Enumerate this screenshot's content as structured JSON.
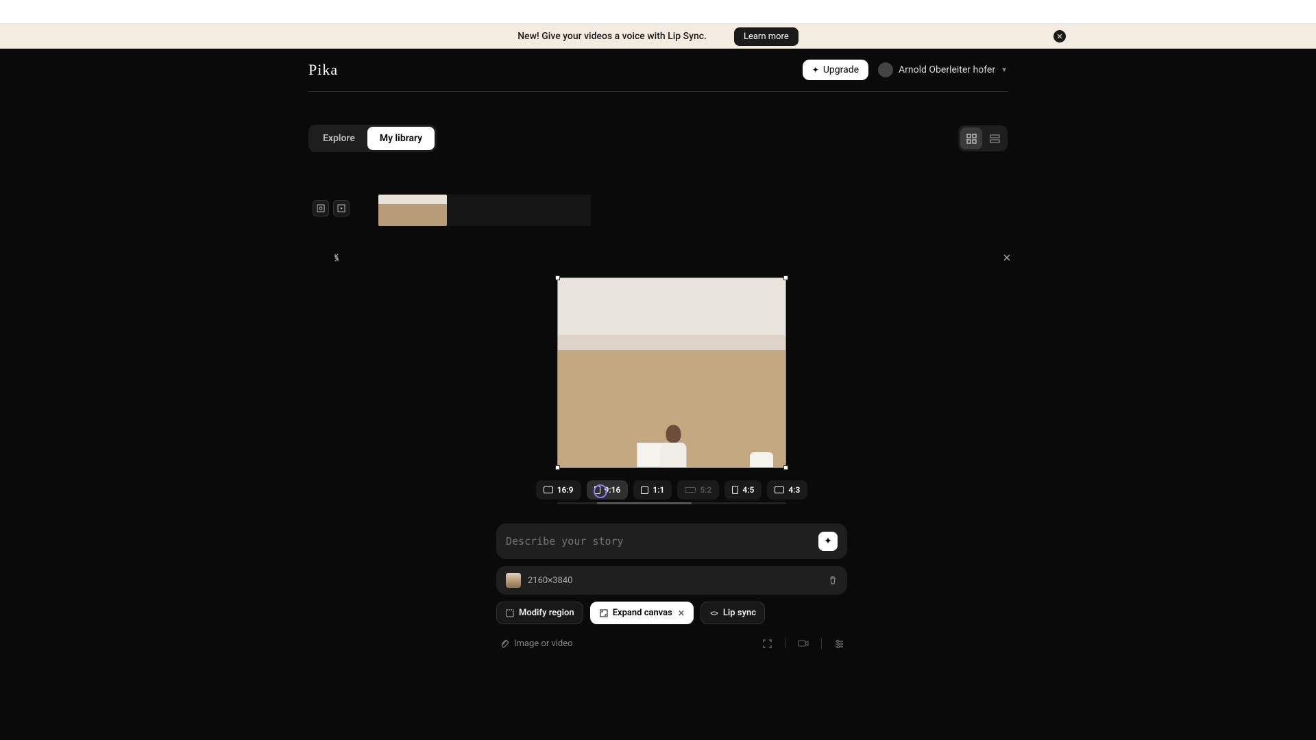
{
  "banner": {
    "text": "New! Give your videos a voice with Lip Sync.",
    "button": "Learn more"
  },
  "header": {
    "logo": "Pika",
    "upgrade": "Upgrade",
    "user": "Arnold Oberleiter hofer"
  },
  "tabs": {
    "explore": "Explore",
    "library": "My library"
  },
  "ratios": {
    "r1": "16:9",
    "r2": "9:16",
    "r3": "1:1",
    "r4": "5:2",
    "r5": "4:5",
    "r6": "4:3"
  },
  "prompt": {
    "placeholder": "Describe your story"
  },
  "asset": {
    "dimensions": "2160×3840"
  },
  "actions": {
    "modify": "Modify region",
    "expand": "Expand canvas",
    "lipsync": "Lip sync"
  },
  "bottom": {
    "attach": "Image or video"
  }
}
